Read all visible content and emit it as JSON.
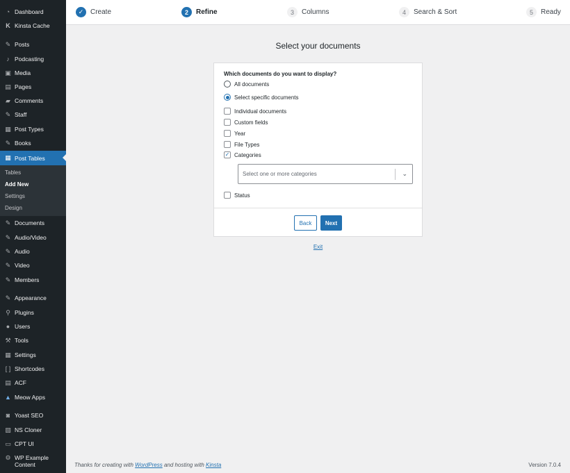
{
  "sidebar": {
    "items": [
      {
        "label": "Dashboard",
        "icon": "dashboard-icon"
      },
      {
        "label": "Kinsta Cache",
        "icon": "kinsta-icon"
      },
      {
        "label": "Posts",
        "icon": "pin-icon"
      },
      {
        "label": "Podcasting",
        "icon": "microphone-icon"
      },
      {
        "label": "Media",
        "icon": "media-icon"
      },
      {
        "label": "Pages",
        "icon": "pages-icon"
      },
      {
        "label": "Comments",
        "icon": "comments-icon"
      },
      {
        "label": "Staff",
        "icon": "pin-icon"
      },
      {
        "label": "Post Types",
        "icon": "post-types-icon"
      },
      {
        "label": "Books",
        "icon": "pin-icon"
      },
      {
        "label": "Post Tables",
        "icon": "table-icon"
      },
      {
        "label": "Documents",
        "icon": "pin-icon"
      },
      {
        "label": "Audio/Video",
        "icon": "pin-icon"
      },
      {
        "label": "Audio",
        "icon": "pin-icon"
      },
      {
        "label": "Video",
        "icon": "pin-icon"
      },
      {
        "label": "Members",
        "icon": "pin-icon"
      },
      {
        "label": "Appearance",
        "icon": "brush-icon"
      },
      {
        "label": "Plugins",
        "icon": "plugin-icon"
      },
      {
        "label": "Users",
        "icon": "users-icon"
      },
      {
        "label": "Tools",
        "icon": "wrench-icon"
      },
      {
        "label": "Settings",
        "icon": "settings-icon"
      },
      {
        "label": "Shortcodes",
        "icon": "brackets-icon"
      },
      {
        "label": "ACF",
        "icon": "acf-icon"
      },
      {
        "label": "Meow Apps",
        "icon": "meow-icon"
      },
      {
        "label": "Yoast SEO",
        "icon": "yoast-icon"
      },
      {
        "label": "NS Cloner",
        "icon": "cloner-icon"
      },
      {
        "label": "CPT UI",
        "icon": "cpt-icon"
      },
      {
        "label": "WP Example Content",
        "icon": "gear-icon"
      }
    ],
    "submenu": [
      "Tables",
      "Add New",
      "Settings",
      "Design"
    ]
  },
  "steps": [
    {
      "num": "✓",
      "label": "Create",
      "state": "done"
    },
    {
      "num": "2",
      "label": "Refine",
      "state": "current"
    },
    {
      "num": "3",
      "label": "Columns",
      "state": "todo"
    },
    {
      "num": "4",
      "label": "Search & Sort",
      "state": "todo"
    },
    {
      "num": "5",
      "label": "Ready",
      "state": "todo"
    }
  ],
  "main": {
    "title": "Select your documents",
    "question": "Which documents do you want to display?",
    "radios": [
      "All documents",
      "Select specific documents"
    ],
    "checkboxes": [
      "Individual documents",
      "Custom fields",
      "Year",
      "File Types",
      "Categories",
      "Status"
    ],
    "category_placeholder": "Select one or more categories",
    "back_label": "Back",
    "next_label": "Next",
    "exit_label": "Exit"
  },
  "footer": {
    "prefix": "Thanks for creating with",
    "wp_link": "WordPress",
    "middle": "and hosting with",
    "kinsta_link": "Kinsta",
    "version": "Version 7.0.4"
  },
  "colors": {
    "accent": "#2271b1",
    "sidebar_bg": "#1d2327",
    "page_bg": "#f0f0f1"
  }
}
